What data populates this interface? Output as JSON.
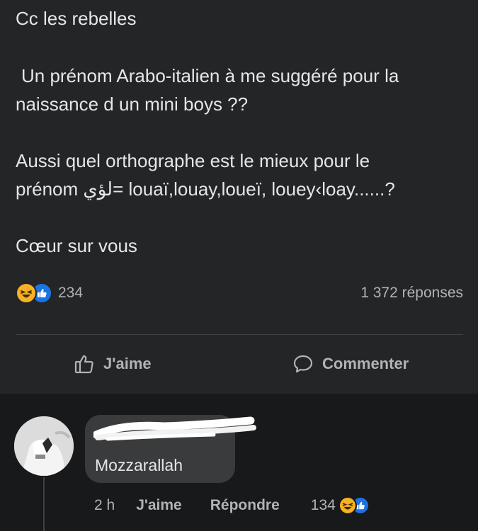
{
  "post": {
    "line1": "Cc les rebelles",
    "line2": "Un prénom Arabo-italien à me suggéré pour la",
    "line3": "naissance d un mini boys ??",
    "line4": "Aussi quel orthographe est le mieux pour le",
    "line5": "prénom لؤي= louaï,louay,loueï, louey‹loay......?",
    "line6": "Cœur sur vous"
  },
  "stats": {
    "reaction_count": "234",
    "replies": "1 372 réponses",
    "reaction_icons": [
      "haha-emoji-icon",
      "like-emoji-icon"
    ]
  },
  "actions": {
    "like": "J'aime",
    "comment": "Commenter"
  },
  "comment": {
    "text": "Mozzarallah",
    "time": "2 h",
    "like": "J'aime",
    "reply": "Répondre",
    "reaction_count": "134"
  },
  "colors": {
    "background": "#18191a",
    "card": "#242526",
    "bubble": "#3a3b3c",
    "text": "#e4e6eb",
    "muted": "#b0b3b8",
    "haha": "#f7b125",
    "like": "#1b74e4"
  }
}
